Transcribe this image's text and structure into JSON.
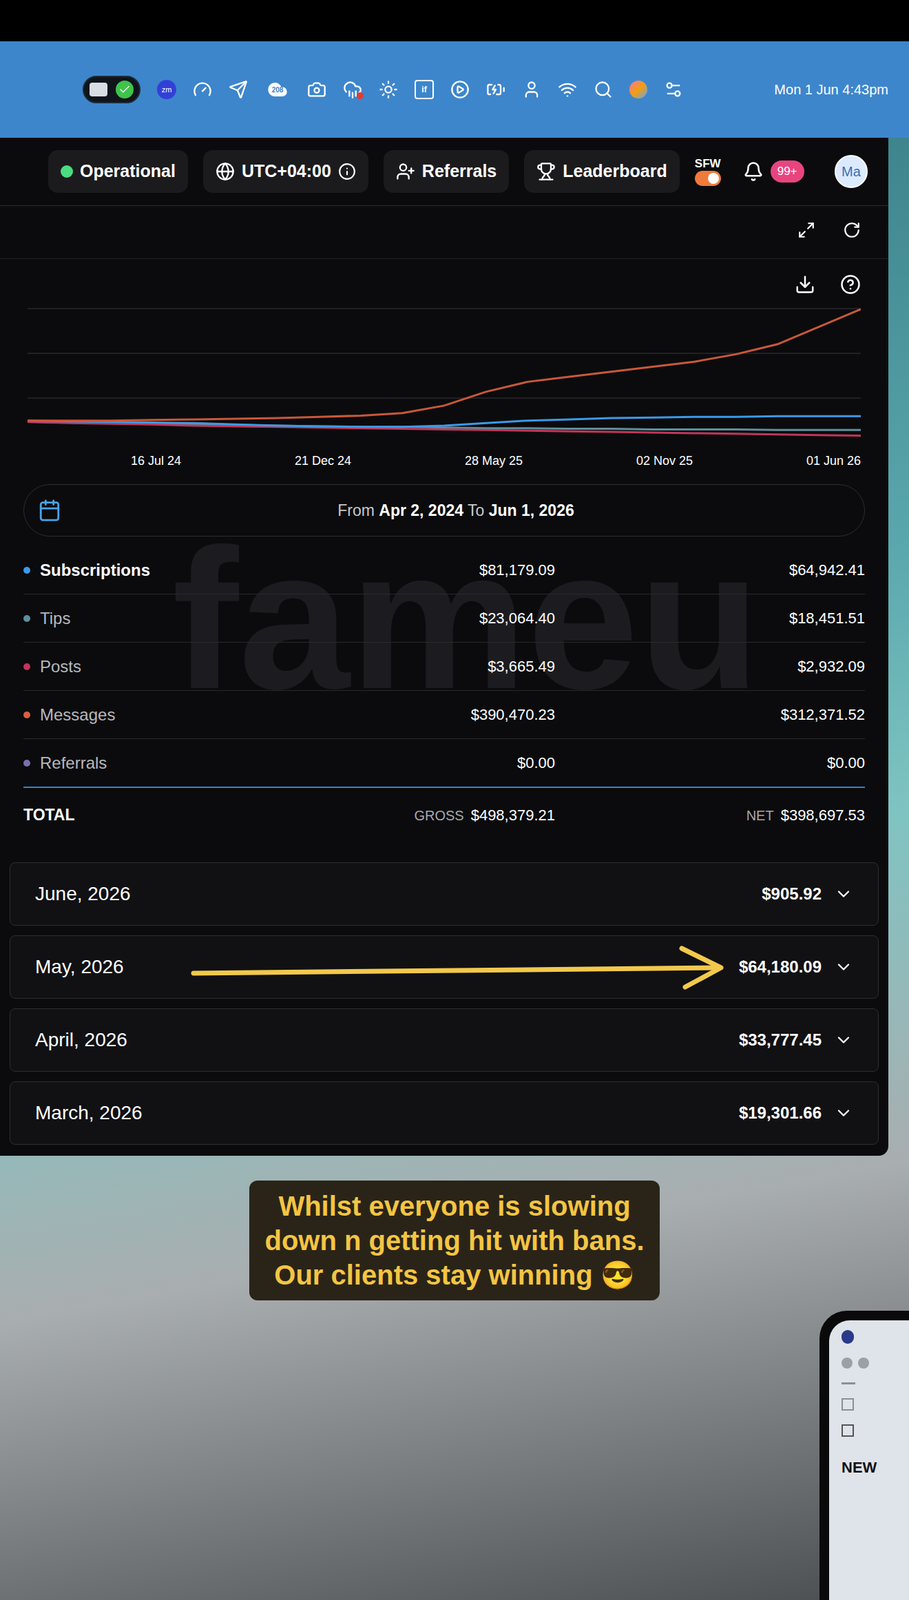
{
  "menubar": {
    "zoom_badge": "zm",
    "cloud_count": "208",
    "app_badge": "if",
    "clock": "Mon 1 Jun 4:43pm"
  },
  "header": {
    "status": {
      "label": "Operational",
      "color": "#4ade80"
    },
    "timezone": "UTC+04:00",
    "links": [
      {
        "label": "Referrals",
        "kind": "referrals"
      },
      {
        "label": "Leaderboard",
        "kind": "leaderboard"
      }
    ],
    "sfw": {
      "label": "SFW",
      "on": true
    },
    "notifications": "99+",
    "avatar": "Ma"
  },
  "chart": {
    "x_ticks": [
      "16 Jul 24",
      "21 Dec 24",
      "28 May 25",
      "02 Nov 25",
      "01 Jun 26"
    ],
    "series": [
      {
        "name": "Tips",
        "color": "#5f8f9c",
        "values": [
          14,
          13.5,
          13,
          12.5,
          12,
          11.5,
          11,
          10.5,
          10,
          10,
          9.5,
          9,
          9,
          8.5,
          8.5,
          8,
          8,
          8,
          7.5,
          7.5,
          7.5
        ]
      },
      {
        "name": "Posts",
        "color": "#c0365a",
        "values": [
          14,
          13,
          12.5,
          12,
          11,
          10.5,
          10,
          9.5,
          9,
          8.5,
          8,
          7.5,
          7,
          6.5,
          6,
          5.5,
          5,
          4.5,
          4,
          3.5,
          3
        ]
      },
      {
        "name": "Subscriptions",
        "color": "#3b9ae8",
        "values": [
          15,
          14.5,
          14,
          13.5,
          13,
          12,
          11,
          10.5,
          10,
          10,
          11,
          13,
          15,
          16,
          17,
          17.5,
          18,
          18,
          18.5,
          18.5,
          18.5
        ]
      },
      {
        "name": "Messages",
        "color": "#c9583a",
        "values": [
          15,
          15,
          15,
          15.5,
          16,
          16.5,
          17,
          18,
          19,
          21,
          27,
          38,
          46,
          50,
          54,
          58,
          62,
          68,
          76,
          90,
          104
        ]
      }
    ]
  },
  "date_range": {
    "from_label": "From",
    "from": "Apr 2, 2024",
    "to_label": "To",
    "to": "Jun 1, 2026"
  },
  "watermark": "fameu",
  "breakdown": [
    {
      "name": "Subscriptions",
      "gross": "$81,179.09",
      "net": "$64,942.41",
      "color": "#3b9ae8",
      "selected": true
    },
    {
      "name": "Tips",
      "gross": "$23,064.40",
      "net": "$18,451.51",
      "color": "#5f8f9c",
      "selected": false
    },
    {
      "name": "Posts",
      "gross": "$3,665.49",
      "net": "$2,932.09",
      "color": "#c0365a",
      "selected": false
    },
    {
      "name": "Messages",
      "gross": "$390,470.23",
      "net": "$312,371.52",
      "color": "#d9603b",
      "selected": false
    },
    {
      "name": "Referrals",
      "gross": "$0.00",
      "net": "$0.00",
      "color": "#7a6fb0",
      "selected": false
    }
  ],
  "total": {
    "label": "TOTAL",
    "gross_label": "GROSS",
    "gross": "$498,379.21",
    "net_label": "NET",
    "net": "$398,697.53"
  },
  "months": [
    {
      "label": "June, 2026",
      "amount": "$905.92",
      "expanded": false,
      "arrow": false
    },
    {
      "label": "May, 2026",
      "amount": "$64,180.09",
      "expanded": false,
      "arrow": true
    },
    {
      "label": "April, 2026",
      "amount": "$33,777.45",
      "expanded": false,
      "arrow": false
    },
    {
      "label": "March, 2026",
      "amount": "$19,301.66",
      "expanded": false,
      "arrow": false
    }
  ],
  "caption": [
    "Whilst everyone is slowing",
    "down n getting hit with bans.",
    "Our clients stay winning 😎"
  ],
  "phone": {
    "label": "NEW"
  }
}
